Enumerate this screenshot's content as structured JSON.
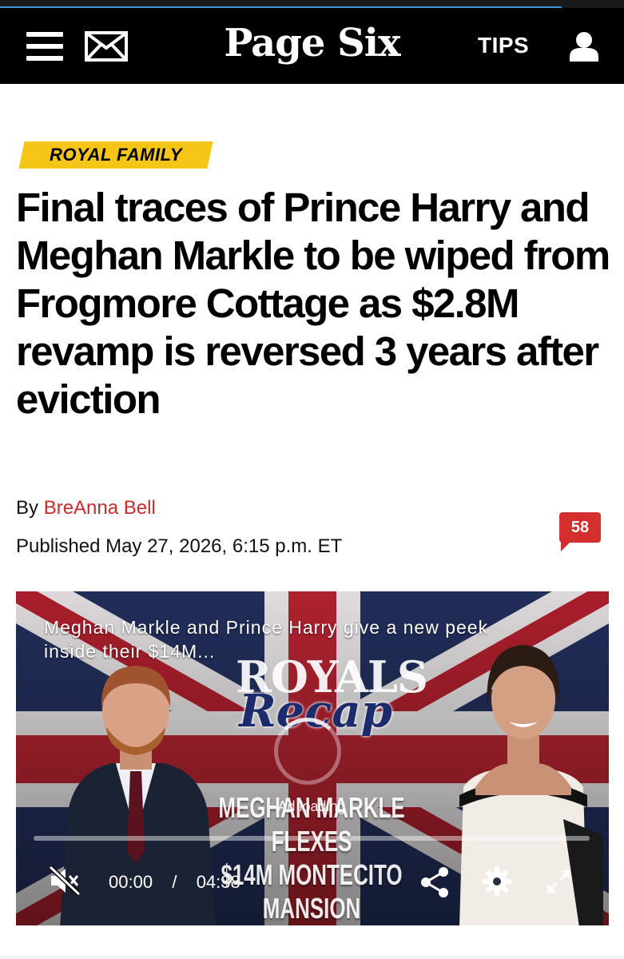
{
  "brand": {
    "logo_text": "Page Six",
    "tips_label": "TIPS"
  },
  "page": {
    "load_progress": 0.9
  },
  "article": {
    "category": "ROYAL FAMILY",
    "headline": "Final traces of Prince Harry and Meghan Markle to be wiped from Frogmore Cottage as $2.8M revamp is reversed 3 years after eviction",
    "byline_prefix": "By",
    "author": "BreAnna Bell",
    "published": "Published May 27, 2026, 6:15 p.m. ET",
    "comment_count": "58"
  },
  "video": {
    "title": "Meghan Markle and Prince Harry give a new peek inside their $14M...",
    "brand_top": "ROYALS",
    "brand_script": "Recap",
    "overlay_line1": "MEGHAN MARKLE FLEXES",
    "overlay_line2": "$14M MONTECITO MANSION",
    "ad_status": "Ad loading",
    "current_time": "00:00",
    "time_separator": "/",
    "duration": "04:38",
    "progress": 0.0
  },
  "icons": {
    "menu": "hamburger-menu-icon",
    "mail": "envelope-icon",
    "account": "user-silhouette-icon",
    "mute": "muted-speaker-icon",
    "share": "share-icon",
    "settings": "gear-icon",
    "fullscreen": "expand-arrows-icon"
  },
  "colors": {
    "nav_background": "#000000",
    "category_tag": "#f5c518",
    "author_link": "#c92a2a",
    "comment_badge": "#d32f2f",
    "progress_bar": "#4a90d9"
  }
}
